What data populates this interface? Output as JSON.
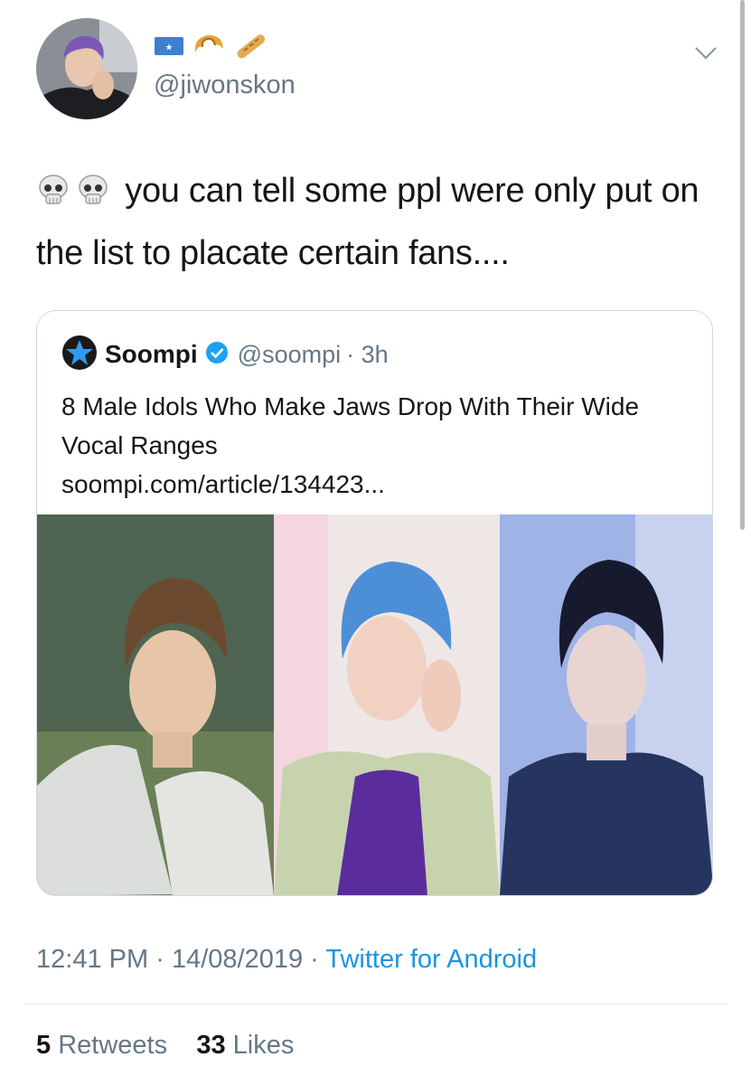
{
  "author": {
    "handle": "@jiwonskon",
    "emoji_icons": [
      "flag-icon",
      "croissant-icon",
      "baguette-icon"
    ]
  },
  "tweet": {
    "text": "you can tell some ppl were only put on the list to placate certain fans....",
    "leading_icons": [
      "skull-icon",
      "skull-icon"
    ]
  },
  "quoted": {
    "name": "Soompi",
    "handle": "@soompi",
    "time": "· 3h",
    "title": "8 Male Idols Who Make Jaws Drop With Their Wide Vocal Ranges",
    "link": "soompi.com/article/134423..."
  },
  "meta": {
    "time": "12:41 PM",
    "sep1": "·",
    "date": "14/08/2019",
    "sep2": "·",
    "source": "Twitter for Android"
  },
  "stats": {
    "retweets_count": "5",
    "retweets_label": "Retweets",
    "likes_count": "33",
    "likes_label": "Likes"
  },
  "colors": {
    "link_blue": "#1b95e0",
    "secondary_text": "#657786",
    "border": "#cfd9de"
  }
}
